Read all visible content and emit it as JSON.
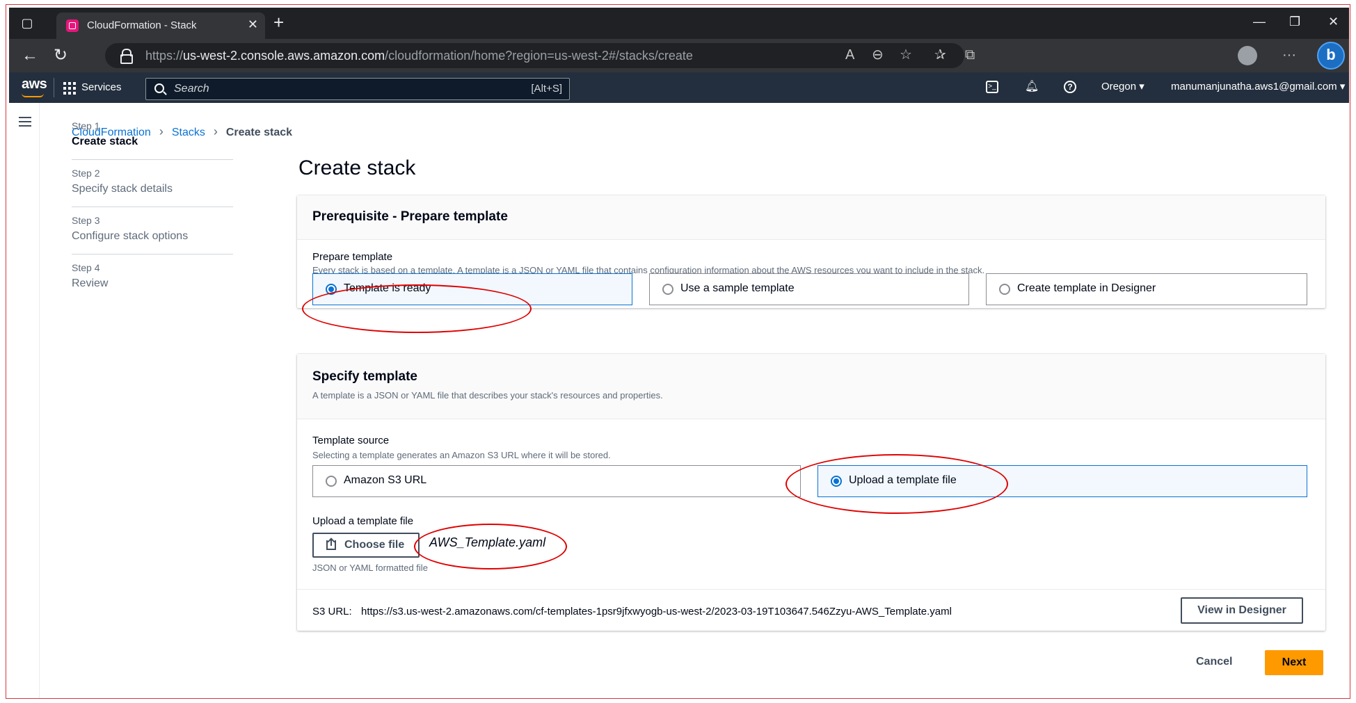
{
  "browser": {
    "tab_title": "CloudFormation - Stack",
    "url_prefix": "https://",
    "url_host": "us-west-2.console.aws.amazon.com",
    "url_path": "/cloudformation/home?region=us-west-2#/stacks/create"
  },
  "aws_nav": {
    "logo": "aws",
    "services_label": "Services",
    "search_placeholder": "Search",
    "search_shortcut": "[Alt+S]",
    "region": "Oregon ▾",
    "account": "manumanjunatha.aws1@gmail.com ▾"
  },
  "breadcrumb": {
    "items": [
      "CloudFormation",
      "Stacks",
      "Create stack"
    ]
  },
  "steps": [
    {
      "num": "Step 1",
      "label": "Create stack"
    },
    {
      "num": "Step 2",
      "label": "Specify stack details"
    },
    {
      "num": "Step 3",
      "label": "Configure stack options"
    },
    {
      "num": "Step 4",
      "label": "Review"
    }
  ],
  "page_title": "Create stack",
  "prereq": {
    "title": "Prerequisite - Prepare template",
    "field_label": "Prepare template",
    "field_desc": "Every stack is based on a template. A template is a JSON or YAML file that contains configuration information about the AWS resources you want to include in the stack.",
    "options": [
      "Template is ready",
      "Use a sample template",
      "Create template in Designer"
    ],
    "selected": "Template is ready"
  },
  "specify": {
    "title": "Specify template",
    "desc": "A template is a JSON or YAML file that describes your stack's resources and properties.",
    "source_label": "Template source",
    "source_desc": "Selecting a template generates an Amazon S3 URL where it will be stored.",
    "options": [
      "Amazon S3 URL",
      "Upload a template file"
    ],
    "selected": "Upload a template file",
    "upload_label": "Upload a template file",
    "choose_file": "Choose file",
    "file_name": "AWS_Template.yaml",
    "file_hint": "JSON or YAML formatted file",
    "s3_label": "S3 URL:",
    "s3_url": "https://s3.us-west-2.amazonaws.com/cf-templates-1psr9jfxwyogb-us-west-2/2023-03-19T103647.546Zzyu-AWS_Template.yaml",
    "view_designer": "View in Designer"
  },
  "footer": {
    "cancel": "Cancel",
    "next": "Next"
  },
  "colors": {
    "aws_nav_bg": "#232f3e",
    "link": "#0972d3",
    "primary_button": "#ff9900",
    "annotation": "#e00000"
  }
}
